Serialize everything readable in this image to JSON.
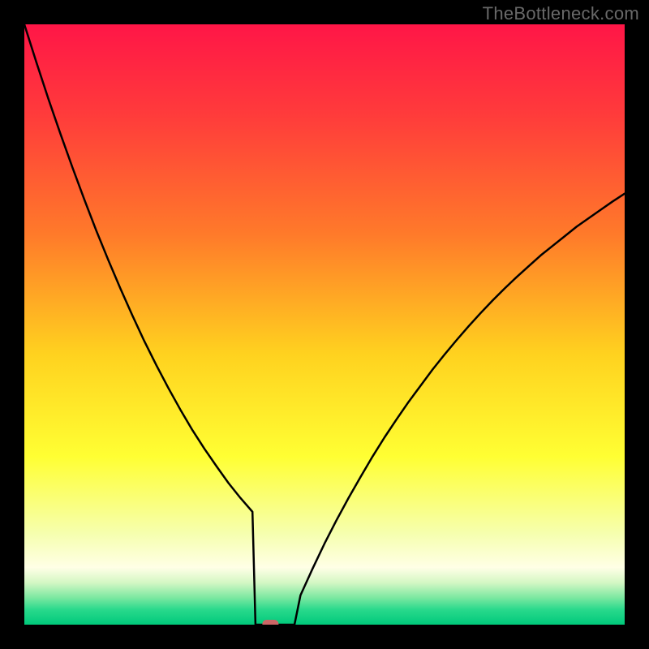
{
  "watermark": "TheBottleneck.com",
  "chart_data": {
    "type": "line",
    "title": "",
    "xlabel": "",
    "ylabel": "",
    "xlim": [
      0,
      1
    ],
    "ylim": [
      0,
      1
    ],
    "x": [
      0.0,
      0.02,
      0.04,
      0.06,
      0.08,
      0.1,
      0.12,
      0.14,
      0.16,
      0.18,
      0.2,
      0.22,
      0.24,
      0.26,
      0.28,
      0.3,
      0.32,
      0.34,
      0.36,
      0.38,
      0.4,
      0.42,
      0.44,
      0.46,
      0.48,
      0.5,
      0.52,
      0.54,
      0.56,
      0.58,
      0.6,
      0.62,
      0.64,
      0.66,
      0.68,
      0.7,
      0.72,
      0.74,
      0.76,
      0.78,
      0.8,
      0.82,
      0.84,
      0.86,
      0.88,
      0.9,
      0.92,
      0.94,
      0.96,
      0.98,
      1.0
    ],
    "values": [
      1.0,
      0.937,
      0.876,
      0.818,
      0.762,
      0.708,
      0.656,
      0.607,
      0.56,
      0.515,
      0.472,
      0.432,
      0.394,
      0.358,
      0.324,
      0.293,
      0.264,
      0.236,
      0.211,
      0.188,
      0.0,
      0.0,
      0.0,
      0.049,
      0.093,
      0.135,
      0.174,
      0.211,
      0.246,
      0.28,
      0.312,
      0.342,
      0.371,
      0.398,
      0.425,
      0.45,
      0.474,
      0.497,
      0.519,
      0.54,
      0.56,
      0.579,
      0.597,
      0.615,
      0.631,
      0.647,
      0.663,
      0.677,
      0.691,
      0.705,
      0.718
    ],
    "min_marker": {
      "x": 0.41,
      "y": 0.0
    },
    "gradient_stops": [
      {
        "offset": 0.0,
        "color": "#ff1647"
      },
      {
        "offset": 0.15,
        "color": "#ff3b3b"
      },
      {
        "offset": 0.35,
        "color": "#ff7a2a"
      },
      {
        "offset": 0.55,
        "color": "#ffd21f"
      },
      {
        "offset": 0.72,
        "color": "#ffff33"
      },
      {
        "offset": 0.85,
        "color": "#f6ffb0"
      },
      {
        "offset": 0.905,
        "color": "#ffffe6"
      },
      {
        "offset": 0.93,
        "color": "#d4f7c4"
      },
      {
        "offset": 0.955,
        "color": "#7ce8a1"
      },
      {
        "offset": 0.975,
        "color": "#29d98c"
      },
      {
        "offset": 1.0,
        "color": "#00c97b"
      }
    ]
  }
}
